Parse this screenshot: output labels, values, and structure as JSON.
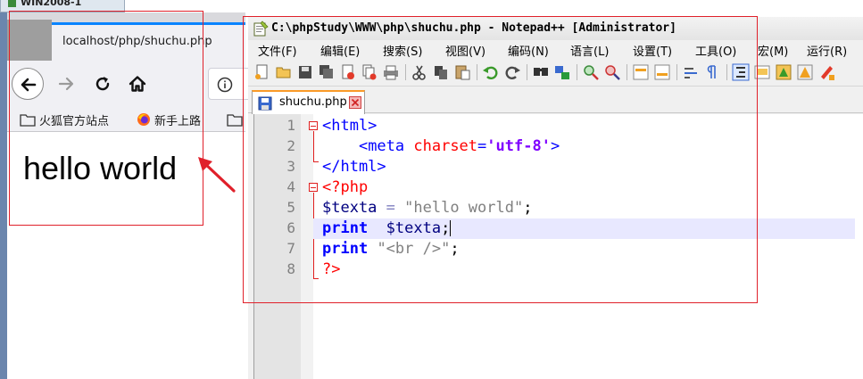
{
  "vm": {
    "tab_label": "WIN2008-1"
  },
  "browser": {
    "tab_title": "localhost/php/shuchu.php",
    "bookmarks": [
      {
        "label": "火狐官方站点",
        "icon": "folder-icon"
      },
      {
        "label": "新手上路",
        "icon": "firefox-icon"
      },
      {
        "label": "",
        "icon": "folder-icon"
      }
    ],
    "page_content": "hello world",
    "colors": {
      "tab_accent": "#0a84ff"
    }
  },
  "notepad": {
    "title": "C:\\phpStudy\\WWW\\php\\shuchu.php - Notepad++ [Administrator]",
    "menu": [
      "文件(F)",
      "编辑(E)",
      "搜索(S)",
      "视图(V)",
      "编码(N)",
      "语言(L)",
      "设置(T)",
      "工具(O)",
      "宏(M)",
      "运行(R)"
    ],
    "active_tab": "shuchu.php",
    "line_numbers": [
      "1",
      "2",
      "3",
      "4",
      "5",
      "6",
      "7",
      "8"
    ],
    "code": {
      "l1_open": "<html>",
      "l2_indent": "    ",
      "l2_tag": "<meta",
      "l2_attr": " charset",
      "l2_eq": "=",
      "l2_val": "'utf-8'",
      "l2_close": ">",
      "l3": "</html>",
      "l4": "<?php",
      "l5_var": "$texta",
      "l5_op": " = ",
      "l5_str": "\"hello world\"",
      "l5_semi": ";",
      "l6_kw": "print",
      "l6_ws": "  ",
      "l6_var": "$texta",
      "l6_semi": ";",
      "l7_kw": "print",
      "l7_ws": " ",
      "l7_str": "\"<br />\"",
      "l7_semi": ";",
      "l8": "?>"
    },
    "colors": {
      "tab_accent": "#fa9a28",
      "current_line": "#e8e8ff"
    }
  },
  "annotation": {
    "color": "#e0202a"
  }
}
